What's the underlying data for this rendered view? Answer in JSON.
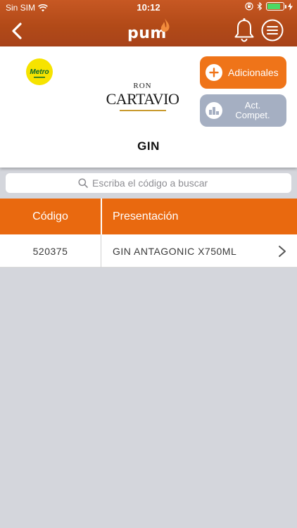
{
  "status_bar": {
    "carrier": "Sin SIM",
    "time": "10:12",
    "battery_level": 0.8
  },
  "nav": {
    "logo_text": "pum",
    "icons": [
      "back-chevron-icon",
      "bell-icon",
      "menu-lines-icon"
    ]
  },
  "header": {
    "store_logo_text": "Metro",
    "brand_logo_top": "RON",
    "brand_logo_main": "CARTAVIO",
    "buttons": {
      "additional": "Adicionales",
      "competition_line1": "Act.",
      "competition_line2": "Compet."
    },
    "category": "GIN"
  },
  "search": {
    "placeholder": "Escriba el código a buscar",
    "value": ""
  },
  "table": {
    "headers": {
      "code": "Código",
      "presentation": "Presentación"
    },
    "rows": [
      {
        "code": "520375",
        "presentation": "GIN ANTAGONIC X750ML"
      }
    ]
  },
  "colors": {
    "nav_bar": "#b24a18",
    "accent_orange": "#ef7419",
    "table_header": "#e9690f",
    "disabled_button": "#a5afc2",
    "background": "#d4d6dc"
  }
}
